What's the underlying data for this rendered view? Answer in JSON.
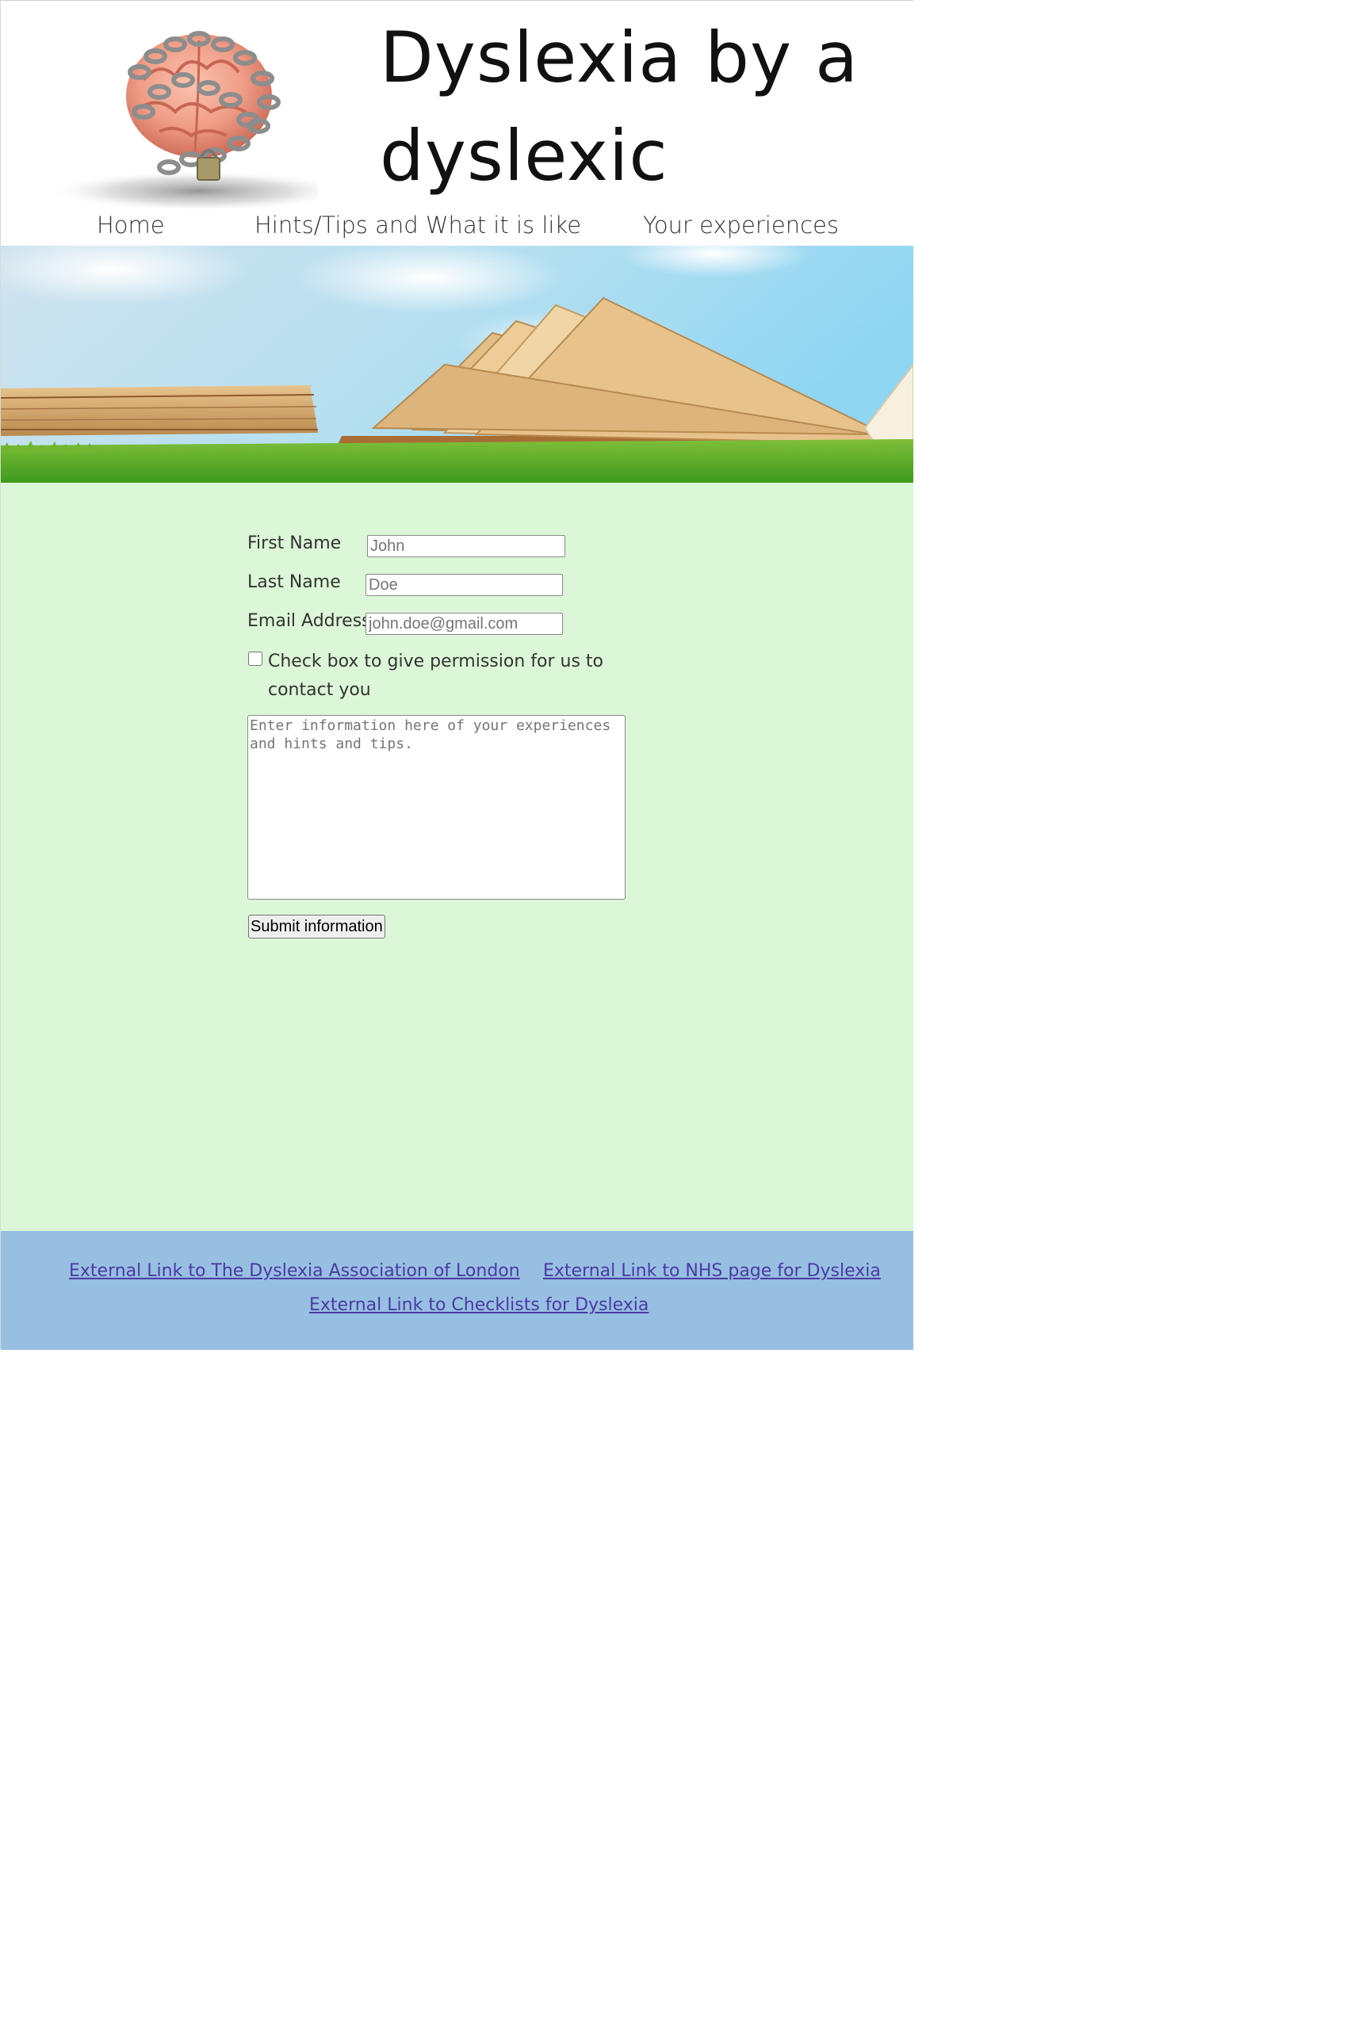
{
  "header": {
    "title": "Dyslexia by a dyslexic",
    "logo_icon": "brain-in-chains-icon"
  },
  "nav": {
    "items": [
      {
        "label": "Home"
      },
      {
        "label": "Hints/Tips and What it is like"
      },
      {
        "label": "Your experiences"
      }
    ]
  },
  "hero": {
    "image": "open-books-on-grass-image"
  },
  "form": {
    "first_name": {
      "label": "First Name",
      "placeholder": "John"
    },
    "last_name": {
      "label": "Last Name",
      "placeholder": "Doe"
    },
    "email": {
      "label": "Email Address",
      "placeholder": "john.doe@gmail.com"
    },
    "contact_permission": {
      "label": "Check box to give permission for us to contact you",
      "checked": false
    },
    "experiences": {
      "placeholder": "Enter information here of your experiences and hints and tips."
    },
    "submit_label": "Submit information"
  },
  "footer": {
    "links": [
      {
        "label": "External Link to The Dyslexia Association of London"
      },
      {
        "label": "External Link to NHS page for Dyslexia"
      },
      {
        "label": "External Link to Checklists for Dyslexia"
      }
    ]
  },
  "colors": {
    "main_bg": "#dcf7d7",
    "footer_bg": "#97bfe2",
    "link": "#4b3aa3"
  }
}
